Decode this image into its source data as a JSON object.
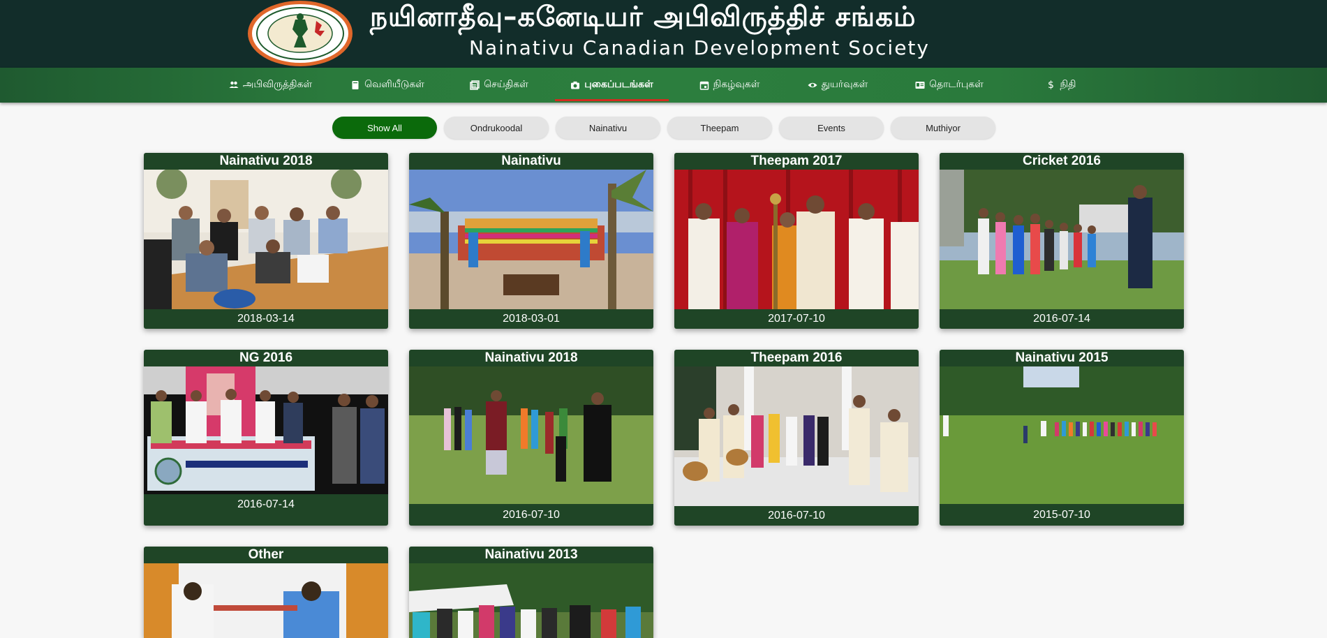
{
  "header": {
    "title_tamil": "நயினாதீவு–கனேடியர் அபிவிருத்திச் சங்கம்",
    "title_english": "Nainativu Canadian Development Society"
  },
  "nav": {
    "items": [
      {
        "label": "அபிவிருத்திகள்",
        "icon": "people-icon"
      },
      {
        "label": "வெளியீடுகள்",
        "icon": "book-icon"
      },
      {
        "label": "செய்திகள்",
        "icon": "news-icon"
      },
      {
        "label": "புகைப்படங்கள்",
        "icon": "camera-icon",
        "active": true
      },
      {
        "label": "நிகழ்வுகள்",
        "icon": "calendar-icon"
      },
      {
        "label": "துயர்வுகள்",
        "icon": "eye-icon"
      },
      {
        "label": "தொடர்புகள்",
        "icon": "contact-card-icon"
      },
      {
        "label": "நிதி",
        "icon": "dollar-icon"
      }
    ],
    "active_underline_color": "#d22c1f"
  },
  "filters": {
    "items": [
      "Show All",
      "Ondrukoodal",
      "Nainativu",
      "Theepam",
      "Events",
      "Muthiyor"
    ],
    "active": "Show All",
    "active_color": "#0b6a0b"
  },
  "gallery": {
    "cards": [
      {
        "title": "Nainativu 2018",
        "date": "2018-03-14"
      },
      {
        "title": "Nainativu",
        "date": "2018-03-01"
      },
      {
        "title": "Theepam 2017",
        "date": "2017-07-10"
      },
      {
        "title": "Cricket 2016",
        "date": "2016-07-14"
      },
      {
        "title": "NG 2016",
        "date": "2016-07-14"
      },
      {
        "title": "Nainativu 2018",
        "date": "2016-07-10"
      },
      {
        "title": "Theepam 2016",
        "date": "2016-07-10"
      },
      {
        "title": "Nainativu 2015",
        "date": "2015-07-10"
      },
      {
        "title": "Other",
        "date": ""
      },
      {
        "title": "Nainativu 2013",
        "date": ""
      }
    ],
    "banner_text": "NAINATIVU CANADIAN DEVELOPMENT SOCIETY",
    "card_color": "#1f4526"
  },
  "colors": {
    "header_bg": "#122d2a",
    "nav_green": "#2a7a3c",
    "page_bg": "#f7f7f7"
  }
}
